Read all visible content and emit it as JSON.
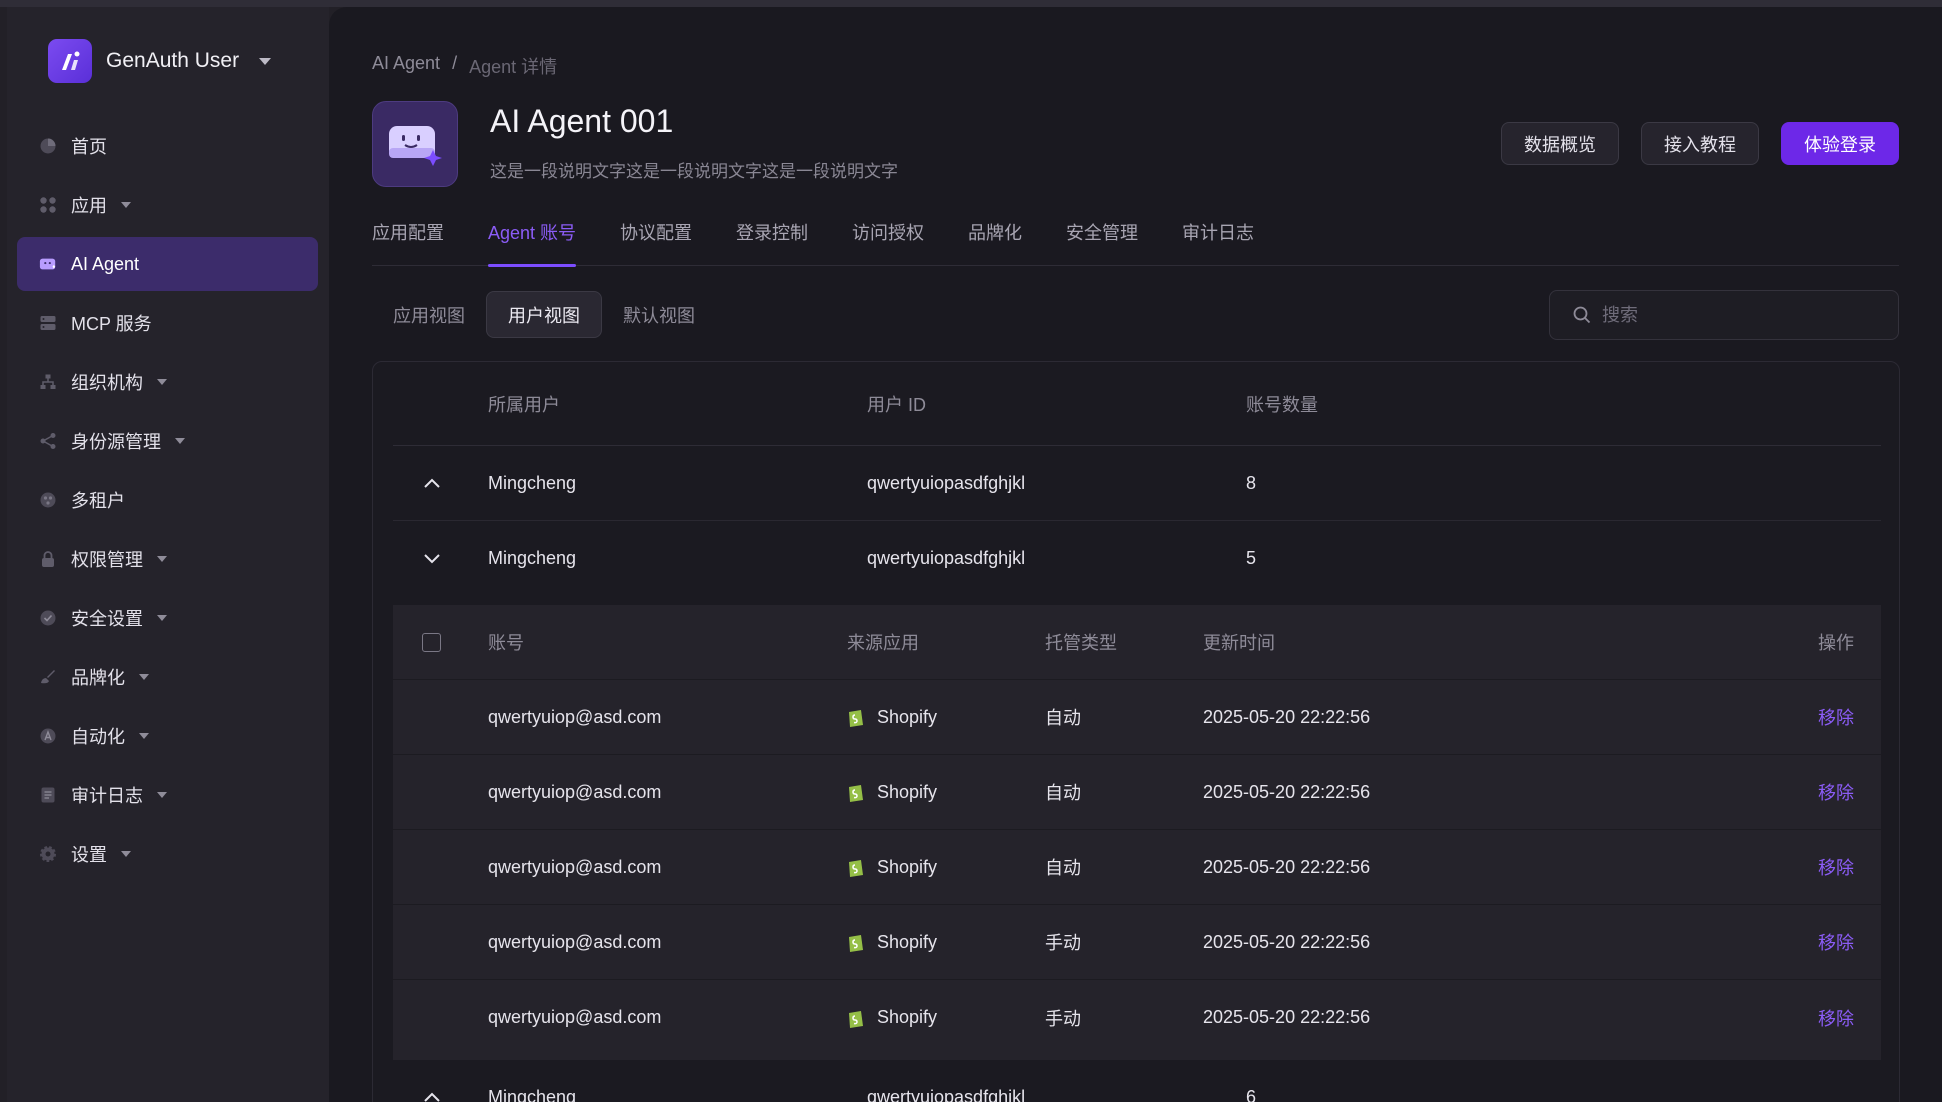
{
  "brand": {
    "name": "GenAuth User"
  },
  "sidebar": {
    "items": [
      {
        "label": "首页",
        "icon": "pie-chart-icon",
        "has_caret": false
      },
      {
        "label": "应用",
        "icon": "grid-icon",
        "has_caret": true
      },
      {
        "label": "AI Agent",
        "icon": "agent-icon",
        "has_caret": false,
        "active": true
      },
      {
        "label": "MCP 服务",
        "icon": "server-icon",
        "has_caret": false
      },
      {
        "label": "组织机构",
        "icon": "org-icon",
        "has_caret": true
      },
      {
        "label": "身份源管理",
        "icon": "share-icon",
        "has_caret": true
      },
      {
        "label": "多租户",
        "icon": "tenant-icon",
        "has_caret": false
      },
      {
        "label": "权限管理",
        "icon": "lock-icon",
        "has_caret": true
      },
      {
        "label": "安全设置",
        "icon": "shield-icon",
        "has_caret": true
      },
      {
        "label": "品牌化",
        "icon": "brush-icon",
        "has_caret": true
      },
      {
        "label": "自动化",
        "icon": "automation-icon",
        "has_caret": true
      },
      {
        "label": "审计日志",
        "icon": "log-icon",
        "has_caret": true
      },
      {
        "label": "设置",
        "icon": "gear-icon",
        "has_caret": true
      }
    ]
  },
  "breadcrumb": {
    "parent": "AI Agent",
    "separator": "/",
    "current": "Agent 详情"
  },
  "agent": {
    "title": "AI Agent 001",
    "description": "这是一段说明文字这是一段说明文字这是一段说明文字"
  },
  "header_buttons": {
    "overview": "数据概览",
    "tutorial": "接入教程",
    "try_login": "体验登录"
  },
  "tabs": [
    "应用配置",
    "Agent 账号",
    "协议配置",
    "登录控制",
    "访问授权",
    "品牌化",
    "安全管理",
    "审计日志"
  ],
  "active_tab": "Agent 账号",
  "views": [
    "应用视图",
    "用户视图",
    "默认视图"
  ],
  "active_view": "用户视图",
  "search": {
    "placeholder": "搜索"
  },
  "user_table": {
    "headers": {
      "user": "所属用户",
      "user_id": "用户 ID",
      "count": "账号数量"
    },
    "rows": [
      {
        "user": "Mingcheng",
        "user_id": "qwertyuiopasdfghjkl",
        "count": "8"
      },
      {
        "user": "Mingcheng",
        "user_id": "qwertyuiopasdfghjkl",
        "count": "5"
      },
      {
        "user": "Mingcheng",
        "user_id": "qwertyuiopasdfghjkl",
        "count": "6"
      }
    ]
  },
  "account_table": {
    "headers": {
      "account": "账号",
      "source": "来源应用",
      "type": "托管类型",
      "updated": "更新时间",
      "action": "操作"
    },
    "rows": [
      {
        "account": "qwertyuiop@asd.com",
        "source": "Shopify",
        "type": "自动",
        "updated": "2025-05-20 22:22:56",
        "action": "移除"
      },
      {
        "account": "qwertyuiop@asd.com",
        "source": "Shopify",
        "type": "自动",
        "updated": "2025-05-20 22:22:56",
        "action": "移除"
      },
      {
        "account": "qwertyuiop@asd.com",
        "source": "Shopify",
        "type": "自动",
        "updated": "2025-05-20 22:22:56",
        "action": "移除"
      },
      {
        "account": "qwertyuiop@asd.com",
        "source": "Shopify",
        "type": "手动",
        "updated": "2025-05-20 22:22:56",
        "action": "移除"
      },
      {
        "account": "qwertyuiop@asd.com",
        "source": "Shopify",
        "type": "手动",
        "updated": "2025-05-20 22:22:56",
        "action": "移除"
      }
    ]
  },
  "colors": {
    "accent": "#6d28e8",
    "link": "#8b5cf6",
    "background": "#1a1920",
    "sidebar": "#25232b"
  }
}
